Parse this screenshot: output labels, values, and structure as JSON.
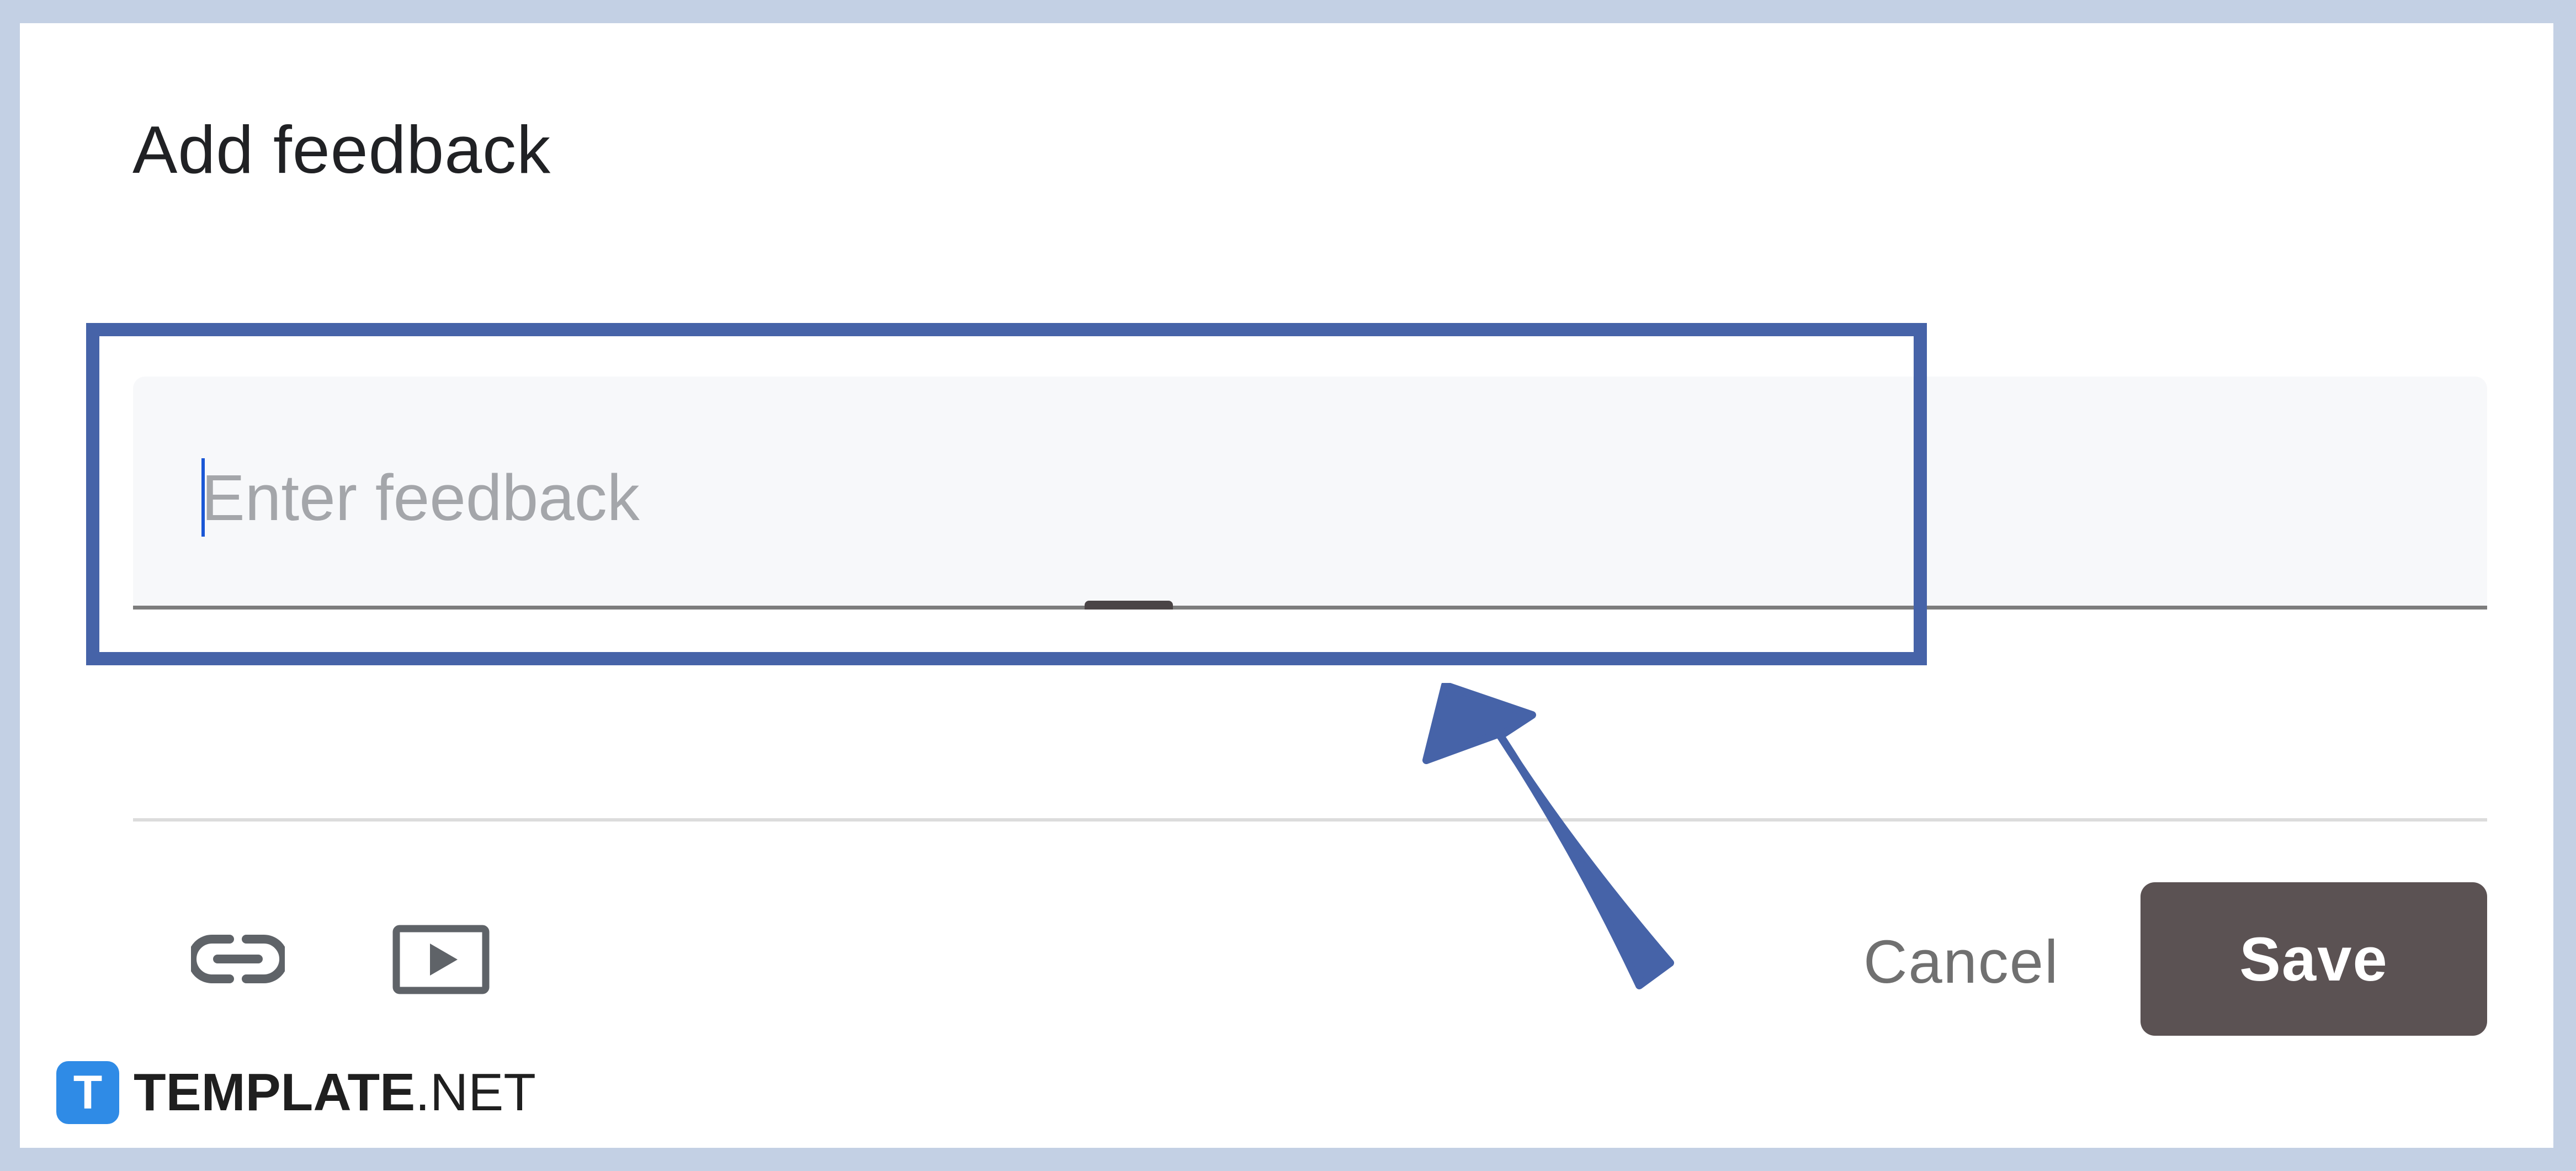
{
  "dialog": {
    "title": "Add feedback"
  },
  "feedback_input": {
    "value": "",
    "placeholder": "Enter feedback"
  },
  "toolbar": {
    "link_icon": "link-icon",
    "video_icon": "youtube-video-icon"
  },
  "actions": {
    "cancel_label": "Cancel",
    "save_label": "Save"
  },
  "annotation": {
    "highlight_color": "#4663a8",
    "arrow_color": "#4663a8"
  },
  "brand": {
    "logo_letter": "T",
    "name_bold": "TEMPLATE",
    "name_suffix": ".NET",
    "logo_color": "#2f8be6"
  },
  "colors": {
    "background": "#c3d0e4",
    "save_button": "#5b5253",
    "input_background": "#f7f8fa"
  }
}
